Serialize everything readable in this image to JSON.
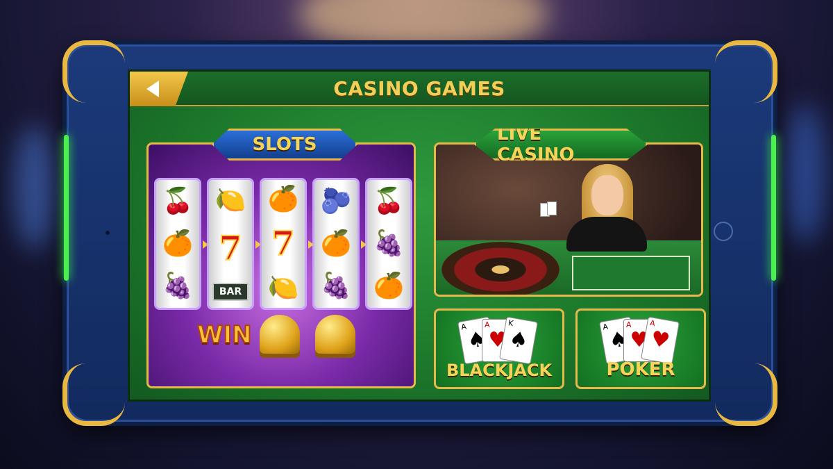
{
  "header": {
    "title": "CASINO GAMES"
  },
  "sections": {
    "slots": {
      "label": "SLOTS"
    },
    "live_casino": {
      "label": "LIVE CASINO"
    },
    "blackjack": {
      "label": "BLACKJACK"
    },
    "poker": {
      "label": "POKER"
    }
  },
  "slot_machine": {
    "reels": [
      [
        "cherries",
        "orange",
        "plum"
      ],
      [
        "lemon",
        "seven",
        "BAR"
      ],
      [
        "orange",
        "seven",
        "lemon"
      ],
      [
        "blueberries",
        "orange",
        "plum"
      ],
      [
        "cherries",
        "plum",
        "orange"
      ]
    ],
    "win_text": "WIN"
  },
  "colors": {
    "accent_gold": "#e7b94a",
    "felt_green": "#1d7a2c",
    "frame_blue": "#1c3a7a",
    "glow_green": "#4cf04c"
  }
}
